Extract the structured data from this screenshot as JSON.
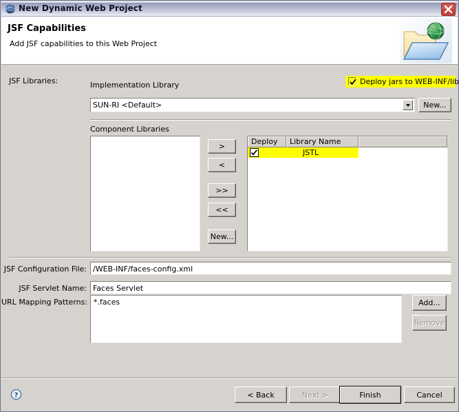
{
  "window": {
    "title": "New Dynamic Web Project",
    "title_icon": "globe-sphere-icon",
    "close_label": "X"
  },
  "header": {
    "title": "JSF Capabilities",
    "subtitle": "Add JSF capabilities to this Web Project",
    "icon": "web-project-folder-globe-icon"
  },
  "form": {
    "jsf_libraries_label": "JSF Libraries:",
    "implementation_library_label": "Implementation Library",
    "implementation_library_value": "SUN-RI <Default>",
    "implementation_new_label": "New...",
    "deploy_jars_label": "Deploy jars to WEB-INF/lib",
    "deploy_jars_checked": true,
    "component_libraries_label": "Component Libraries",
    "available_libraries": [],
    "transfer_buttons": [
      {
        "label": ">",
        "name": "move-right-button"
      },
      {
        "label": "<",
        "name": "move-left-button"
      },
      {
        "label": ">>",
        "name": "move-all-right-button"
      },
      {
        "label": "<<",
        "name": "move-all-left-button"
      },
      {
        "label": "New...",
        "name": "new-component-library-button"
      }
    ],
    "library_table": {
      "columns": [
        "Deploy",
        "Library Name",
        ""
      ],
      "rows": [
        {
          "deploy": true,
          "name": "JSTL",
          "highlighted": true
        }
      ]
    },
    "config_file_label": "JSF Configuration File:",
    "config_file_value": "/WEB-INF/faces-config.xml",
    "servlet_name_label": "JSF Servlet Name:",
    "servlet_name_value": "Faces Servlet",
    "url_mapping_label": "URL Mapping Patterns:",
    "url_mapping_values": "*.faces",
    "add_label": "Add...",
    "remove_label": "Remove",
    "remove_enabled": false
  },
  "footer": {
    "help_icon": "help-question-icon",
    "back_label": "< Back",
    "next_label": "Next >",
    "next_enabled": false,
    "finish_label": "Finish",
    "cancel_label": "Cancel"
  },
  "colors": {
    "highlight": "#ffff00",
    "dialog_bg": "#d6d3ce",
    "title_accent": "#8f96b5",
    "close_red": "#cc3333"
  }
}
